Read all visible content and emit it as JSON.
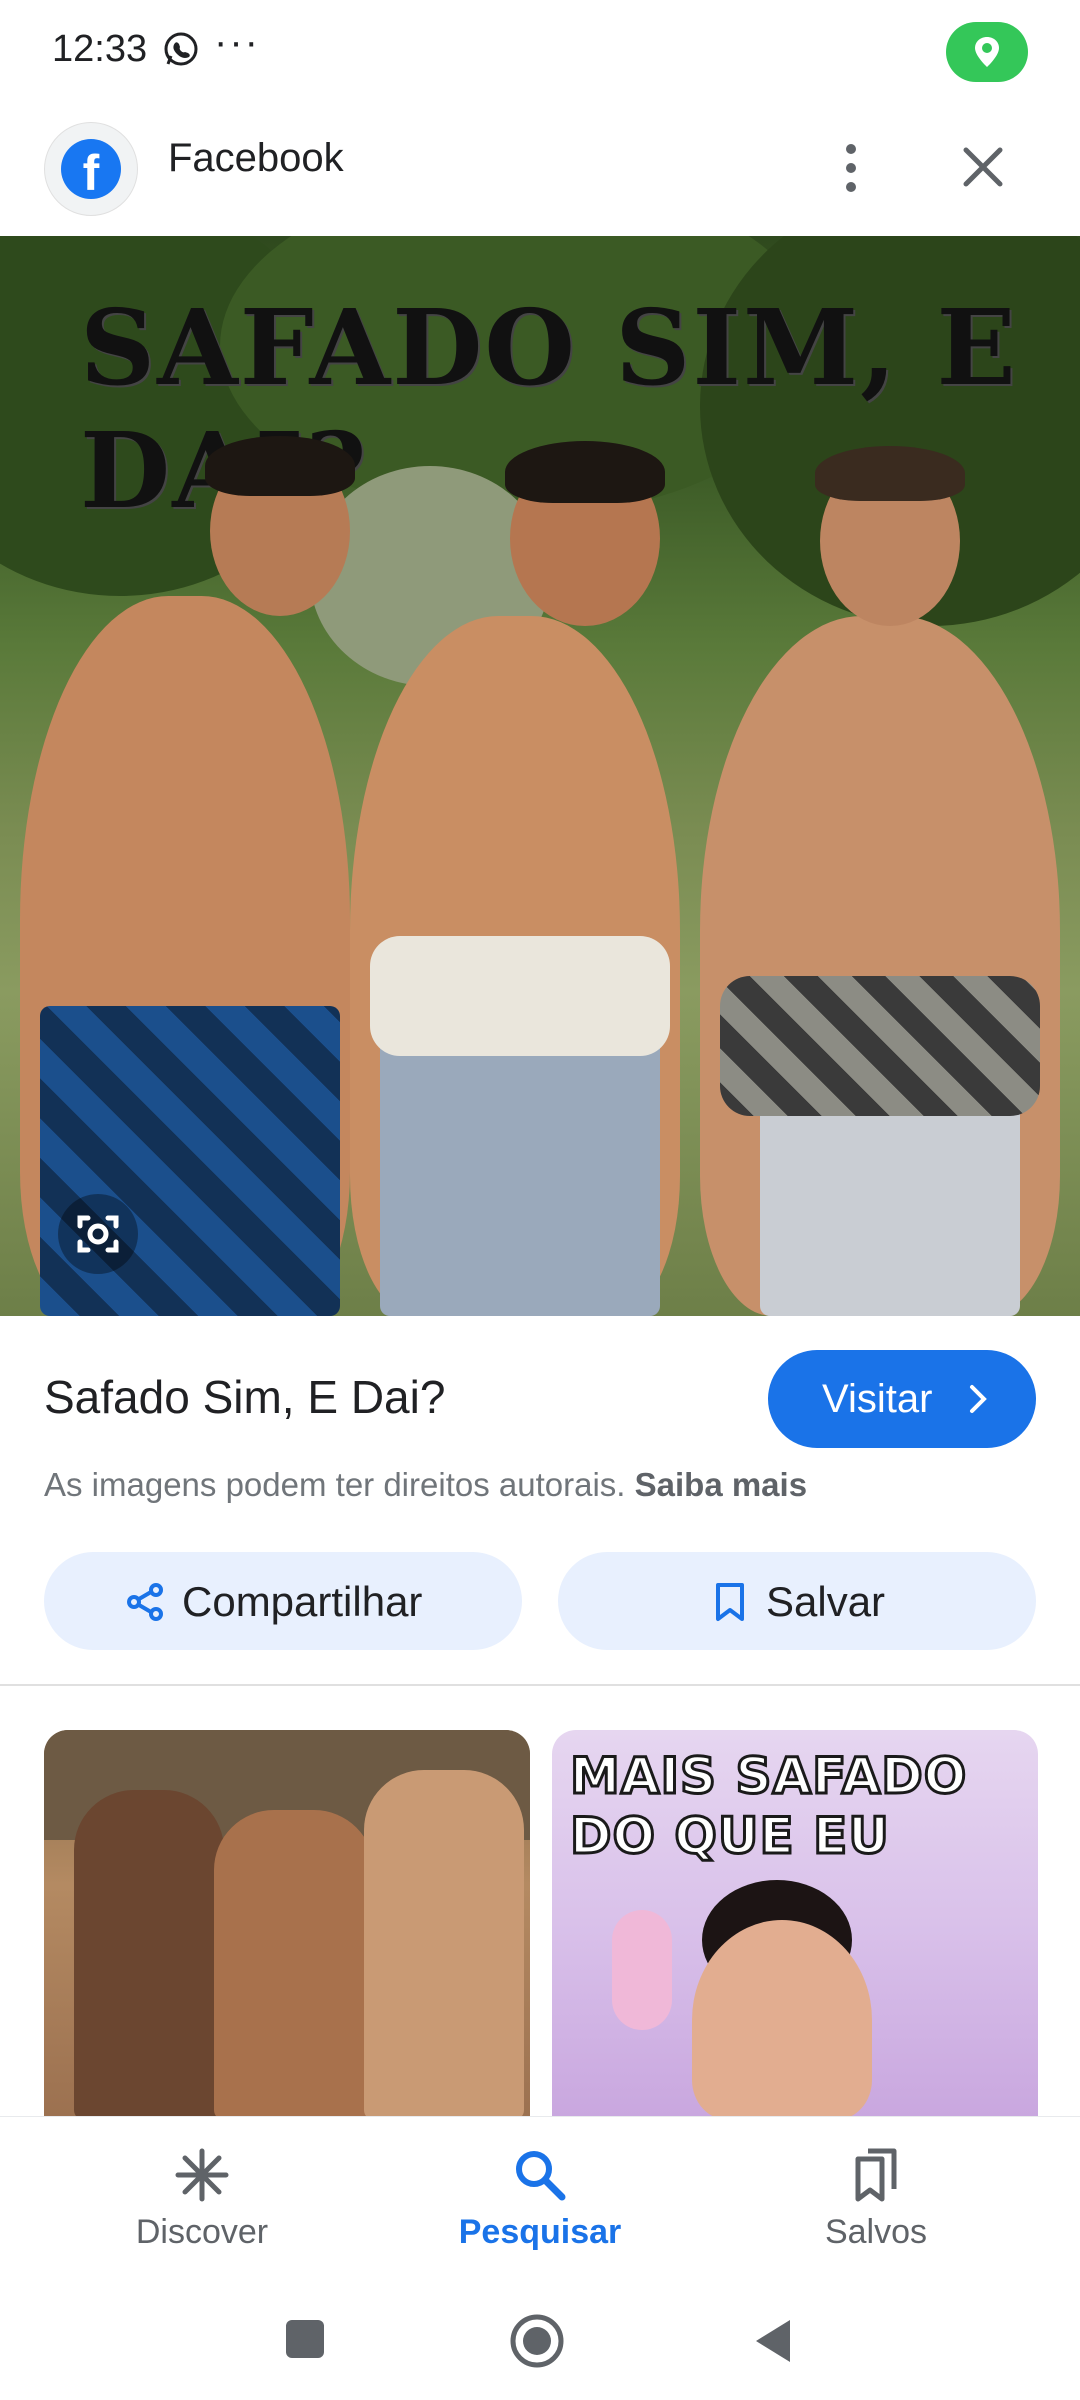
{
  "status_bar": {
    "time": "12:33",
    "overflow": "···",
    "icons": [
      "whatsapp-icon",
      "location-icon"
    ]
  },
  "header": {
    "site_name": "Facebook",
    "logo_letter": "f",
    "icons": [
      "more-vert-icon",
      "close-icon"
    ]
  },
  "hero": {
    "overlay_text": "SAFADO SIM, E DAI?"
  },
  "result": {
    "title": "Safado Sim, E Dai?",
    "visit_label": "Visitar",
    "copyright_text": "As imagens podem ter direitos autorais.",
    "learn_more": "Saiba mais"
  },
  "actions": {
    "share_label": "Compartilhar",
    "save_label": "Salvar"
  },
  "related": {
    "thumb2_text_line1": "MAIS SAFADO",
    "thumb2_text_line2": "DO QUE EU"
  },
  "bottom_nav": {
    "items": [
      {
        "label": "Discover",
        "icon": "discover-asterisk-icon",
        "active": false
      },
      {
        "label": "Pesquisar",
        "icon": "search-icon",
        "active": true
      },
      {
        "label": "Salvos",
        "icon": "saved-bookmarks-icon",
        "active": false
      }
    ]
  },
  "colors": {
    "accent": "#1a73e8",
    "pill_bg": "#e8f0fe",
    "location_badge": "#34c759"
  }
}
